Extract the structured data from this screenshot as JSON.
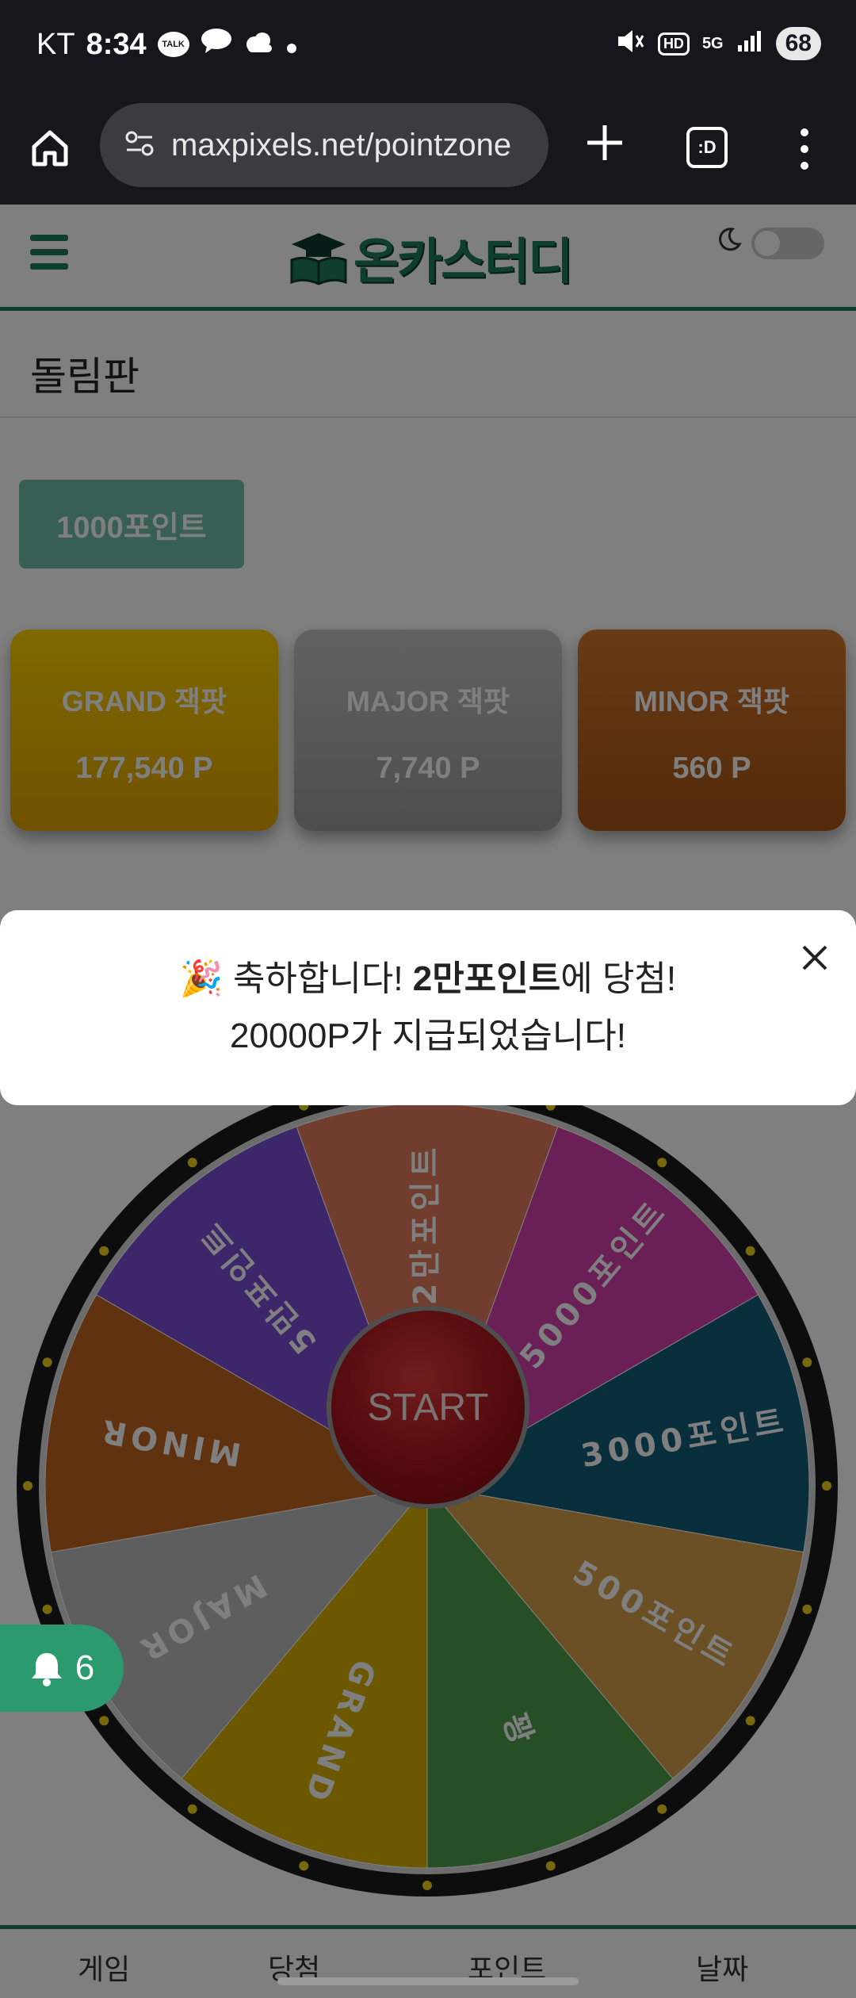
{
  "status_bar": {
    "carrier": "KT",
    "time": "8:34",
    "talk_icon_text": "TALK",
    "hd_label": "HD",
    "network": "5G",
    "battery": "68"
  },
  "browser": {
    "url": "maxpixels.net/pointzone",
    "tabs_label": ":D"
  },
  "header": {
    "logo_text": "온카스터디"
  },
  "page": {
    "title": "돌림판",
    "points_button": "1000포인트"
  },
  "jackpots": [
    {
      "title": "GRAND 잭팟",
      "value": "177,540 P",
      "color": "#ffd100"
    },
    {
      "title": "MAJOR 잭팟",
      "value": "7,740 P",
      "color": "#c4c4c4"
    },
    {
      "title": "MINOR 잭팟",
      "value": "560 P",
      "color": "#d2772a"
    }
  ],
  "wheel": {
    "start_label": "START",
    "segments": [
      {
        "label": "2만포인트",
        "color": "#e07a5f"
      },
      {
        "label": "5000포인트",
        "color": "#d63fae"
      },
      {
        "label": "3000포인트",
        "color": "#135e7a"
      },
      {
        "label": "500포인트",
        "color": "#d9a04b"
      },
      {
        "label": "꽝",
        "color": "#4e9e4a"
      },
      {
        "label": "GRAND",
        "color": "#d9b100"
      },
      {
        "label": "MAJOR",
        "color": "#bdbdbd"
      },
      {
        "label": "MINOR",
        "color": "#c0651f"
      },
      {
        "label": "5만포인트",
        "color": "#7a4fd4"
      }
    ]
  },
  "notification": {
    "count": "6"
  },
  "bottom_nav": [
    "게임",
    "당첨",
    "포인트",
    "날짜"
  ],
  "toast": {
    "emoji": "🎉",
    "prefix": " 축하합니다! ",
    "prize": "2만포인트",
    "suffix": "에 당첨!",
    "line2": "20000P가 지급되었습니다!"
  },
  "colors": {
    "brand": "#1f7a5c",
    "status_bar_bg": "#15171c"
  }
}
